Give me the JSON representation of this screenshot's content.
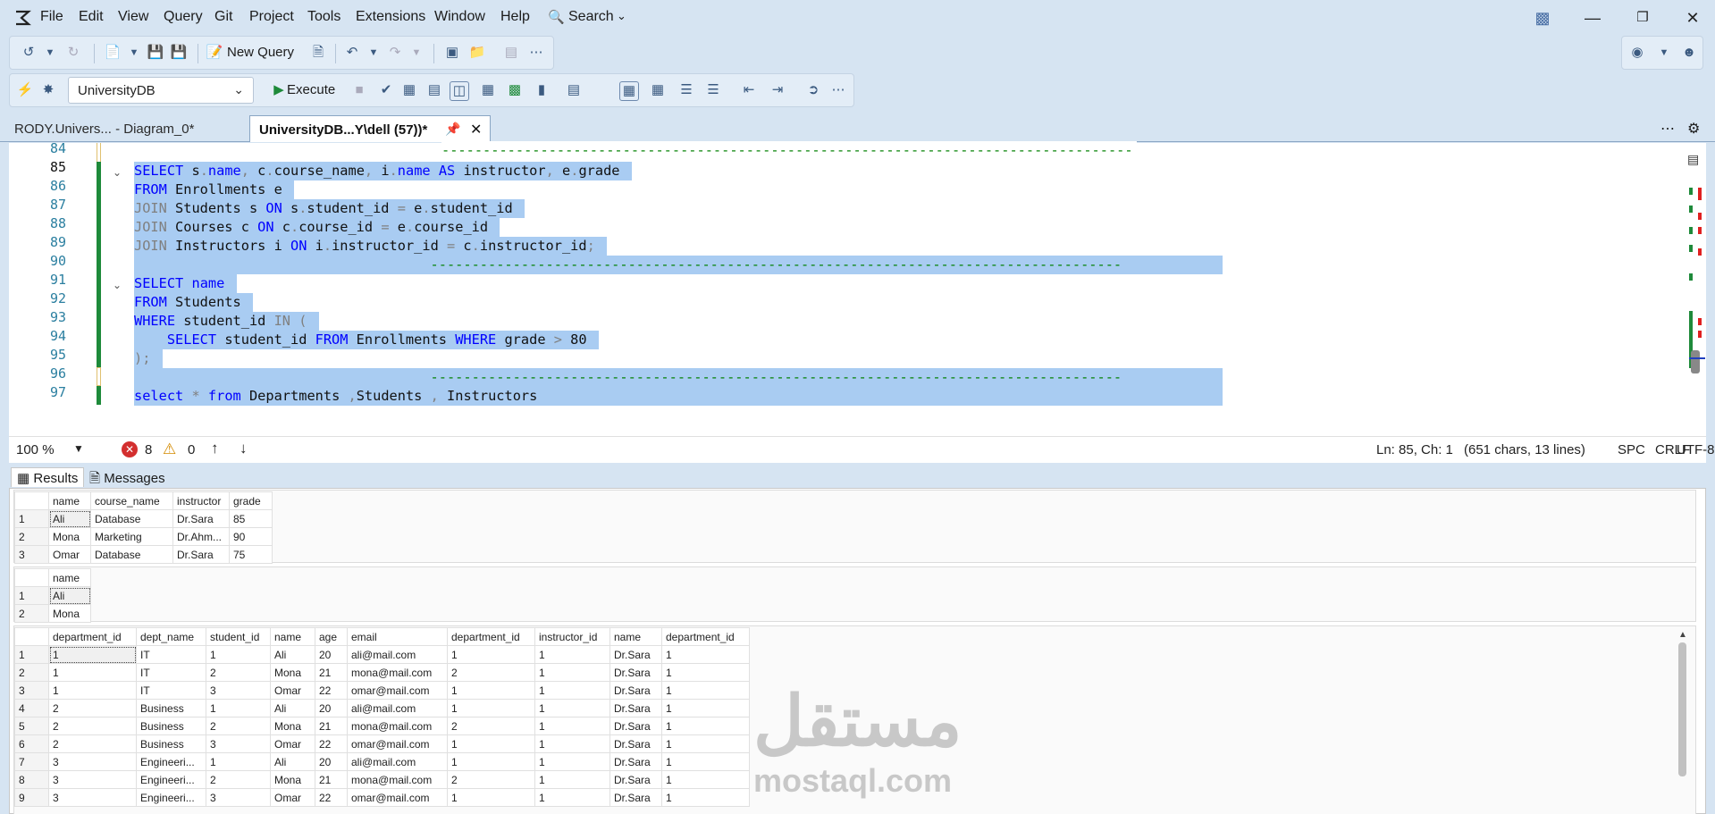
{
  "menu": [
    "File",
    "Edit",
    "View",
    "Query",
    "Git",
    "Project",
    "Tools",
    "Extensions",
    "Window",
    "Help"
  ],
  "search_label": "Search",
  "toolbar": {
    "new_query": "New Query",
    "database": "UniversityDB",
    "execute": "Execute"
  },
  "tabs": [
    {
      "label": "RODY.Univers... - Diagram_0*"
    },
    {
      "label": "UniversityDB...Y\\dell (57))*"
    }
  ],
  "editor": {
    "lines": [
      {
        "num": "84"
      },
      {
        "num": "85"
      },
      {
        "num": "86"
      },
      {
        "num": "87"
      },
      {
        "num": "88"
      },
      {
        "num": "89"
      },
      {
        "num": "90"
      },
      {
        "num": "91"
      },
      {
        "num": "92"
      },
      {
        "num": "93"
      },
      {
        "num": "94"
      },
      {
        "num": "95"
      },
      {
        "num": "96"
      },
      {
        "num": "97"
      }
    ],
    "comment_dashes": "------------------------------------------------------------------------------------"
  },
  "status": {
    "zoom": "100 %",
    "errors": "8",
    "warnings": "0",
    "position": "Ln: 85, Ch: 1",
    "chars": "(651 chars, 13 lines)",
    "indent": "SPC",
    "eol": "CRLF",
    "encoding": "UTF-8"
  },
  "result_tabs": {
    "results": "Results",
    "messages": "Messages"
  },
  "grid1": {
    "headers": [
      "name",
      "course_name",
      "instructor",
      "grade"
    ],
    "rows": [
      [
        "1",
        "Ali",
        "Database",
        "Dr.Sara",
        "85"
      ],
      [
        "2",
        "Mona",
        "Marketing",
        "Dr.Ahm...",
        "90"
      ],
      [
        "3",
        "Omar",
        "Database",
        "Dr.Sara",
        "75"
      ]
    ]
  },
  "grid2": {
    "headers": [
      "name"
    ],
    "rows": [
      [
        "1",
        "Ali"
      ],
      [
        "2",
        "Mona"
      ]
    ]
  },
  "grid3": {
    "headers": [
      "department_id",
      "dept_name",
      "student_id",
      "name",
      "age",
      "email",
      "department_id",
      "instructor_id",
      "name",
      "department_id"
    ],
    "rows": [
      [
        "1",
        "1",
        "IT",
        "1",
        "Ali",
        "20",
        "ali@mail.com",
        "1",
        "1",
        "Dr.Sara",
        "1"
      ],
      [
        "2",
        "1",
        "IT",
        "2",
        "Mona",
        "21",
        "mona@mail.com",
        "2",
        "1",
        "Dr.Sara",
        "1"
      ],
      [
        "3",
        "1",
        "IT",
        "3",
        "Omar",
        "22",
        "omar@mail.com",
        "1",
        "1",
        "Dr.Sara",
        "1"
      ],
      [
        "4",
        "2",
        "Business",
        "1",
        "Ali",
        "20",
        "ali@mail.com",
        "1",
        "1",
        "Dr.Sara",
        "1"
      ],
      [
        "5",
        "2",
        "Business",
        "2",
        "Mona",
        "21",
        "mona@mail.com",
        "2",
        "1",
        "Dr.Sara",
        "1"
      ],
      [
        "6",
        "2",
        "Business",
        "3",
        "Omar",
        "22",
        "omar@mail.com",
        "1",
        "1",
        "Dr.Sara",
        "1"
      ],
      [
        "7",
        "3",
        "Engineeri...",
        "1",
        "Ali",
        "20",
        "ali@mail.com",
        "1",
        "1",
        "Dr.Sara",
        "1"
      ],
      [
        "8",
        "3",
        "Engineeri...",
        "2",
        "Mona",
        "21",
        "mona@mail.com",
        "2",
        "1",
        "Dr.Sara",
        "1"
      ],
      [
        "9",
        "3",
        "Engineeri...",
        "3",
        "Omar",
        "22",
        "omar@mail.com",
        "1",
        "1",
        "Dr.Sara",
        "1"
      ]
    ]
  },
  "watermark": {
    "arabic": "مستقل",
    "latin": "mostaql.com"
  }
}
